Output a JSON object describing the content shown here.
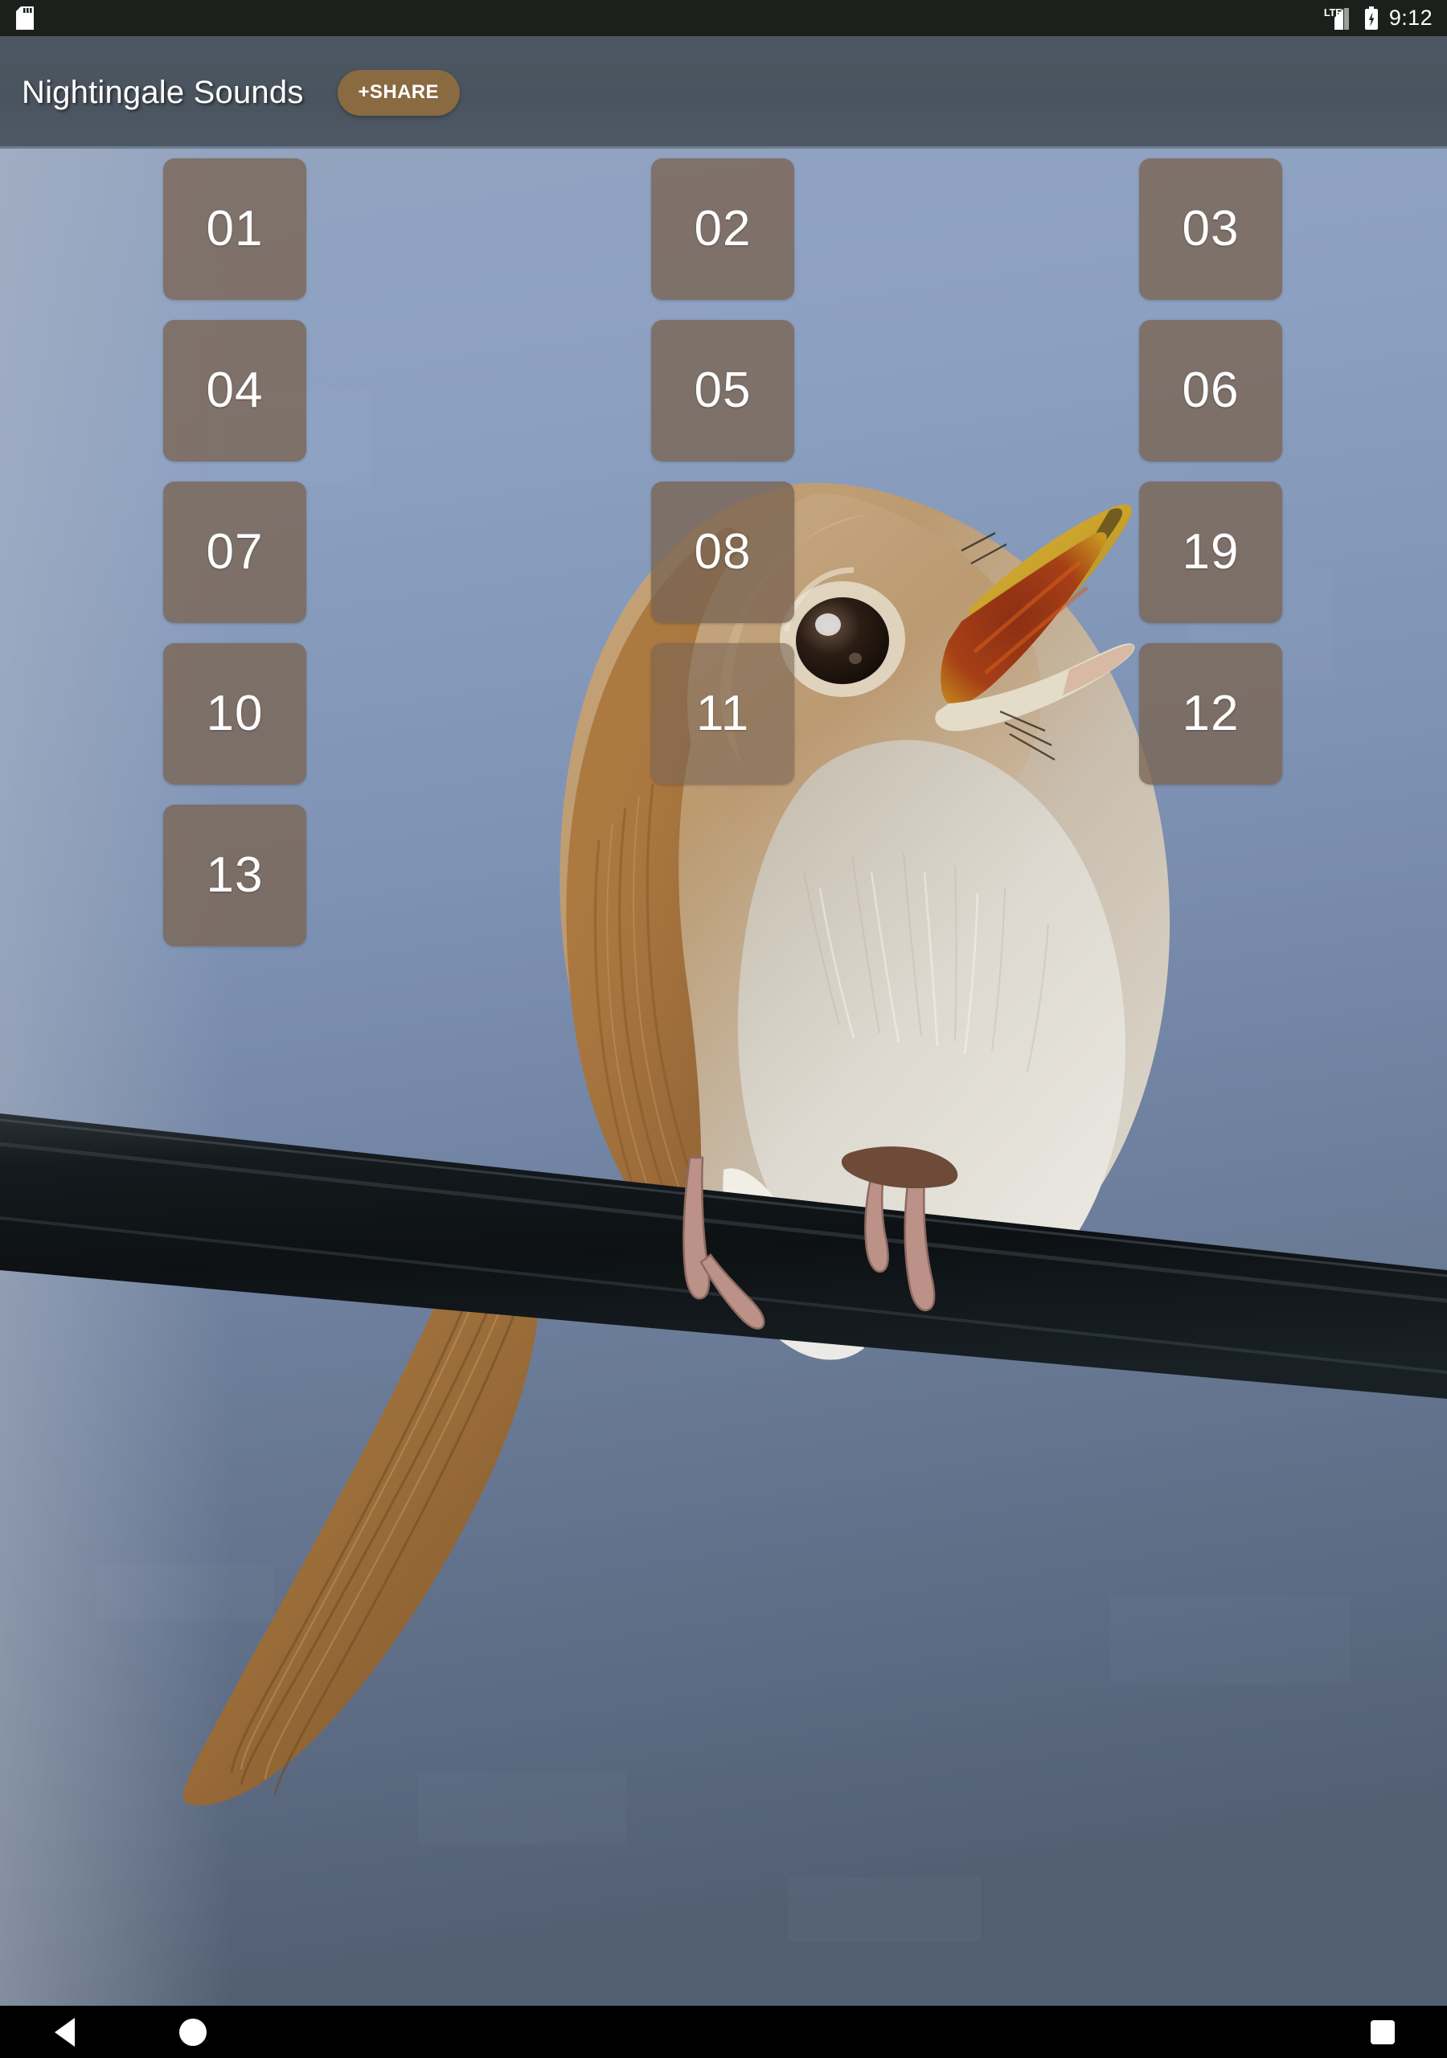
{
  "status_bar": {
    "left_icon": "sd-card-icon",
    "network_label": "LTE",
    "signal_icon": "signal-bars-icon",
    "battery_icon": "battery-charging-icon",
    "time": "9:12",
    "background_color": "#1c201c"
  },
  "app_bar": {
    "title": "Nightingale Sounds",
    "share_label": "+SHARE",
    "share_color": "#8a6a40",
    "background_color": "#4a545f"
  },
  "sound_grid": {
    "button_color": "#7a6554",
    "text_color": "#ffffff",
    "buttons": [
      {
        "label": "01",
        "col": 1,
        "row": 1
      },
      {
        "label": "02",
        "col": 2,
        "row": 1
      },
      {
        "label": "03",
        "col": 3,
        "row": 1
      },
      {
        "label": "04",
        "col": 1,
        "row": 2
      },
      {
        "label": "05",
        "col": 2,
        "row": 2
      },
      {
        "label": "06",
        "col": 3,
        "row": 2
      },
      {
        "label": "07",
        "col": 1,
        "row": 3
      },
      {
        "label": "08",
        "col": 2,
        "row": 3
      },
      {
        "label": "19",
        "col": 3,
        "row": 3
      },
      {
        "label": "10",
        "col": 1,
        "row": 4
      },
      {
        "label": "11",
        "col": 2,
        "row": 4
      },
      {
        "label": "12",
        "col": 3,
        "row": 4
      },
      {
        "label": "13",
        "col": 1,
        "row": 5
      }
    ]
  },
  "background_photo": {
    "subject": "nightingale-bird-singing-on-wire",
    "sky_top_color": "#93a4c0",
    "sky_bottom_color": "#525f73",
    "wire_color": "#14171b",
    "plumage_color": "#a9763f"
  },
  "nav_bar": {
    "back_label": "back-icon",
    "home_label": "home-icon",
    "recent_label": "recent-apps-icon",
    "background_color": "#000000"
  }
}
